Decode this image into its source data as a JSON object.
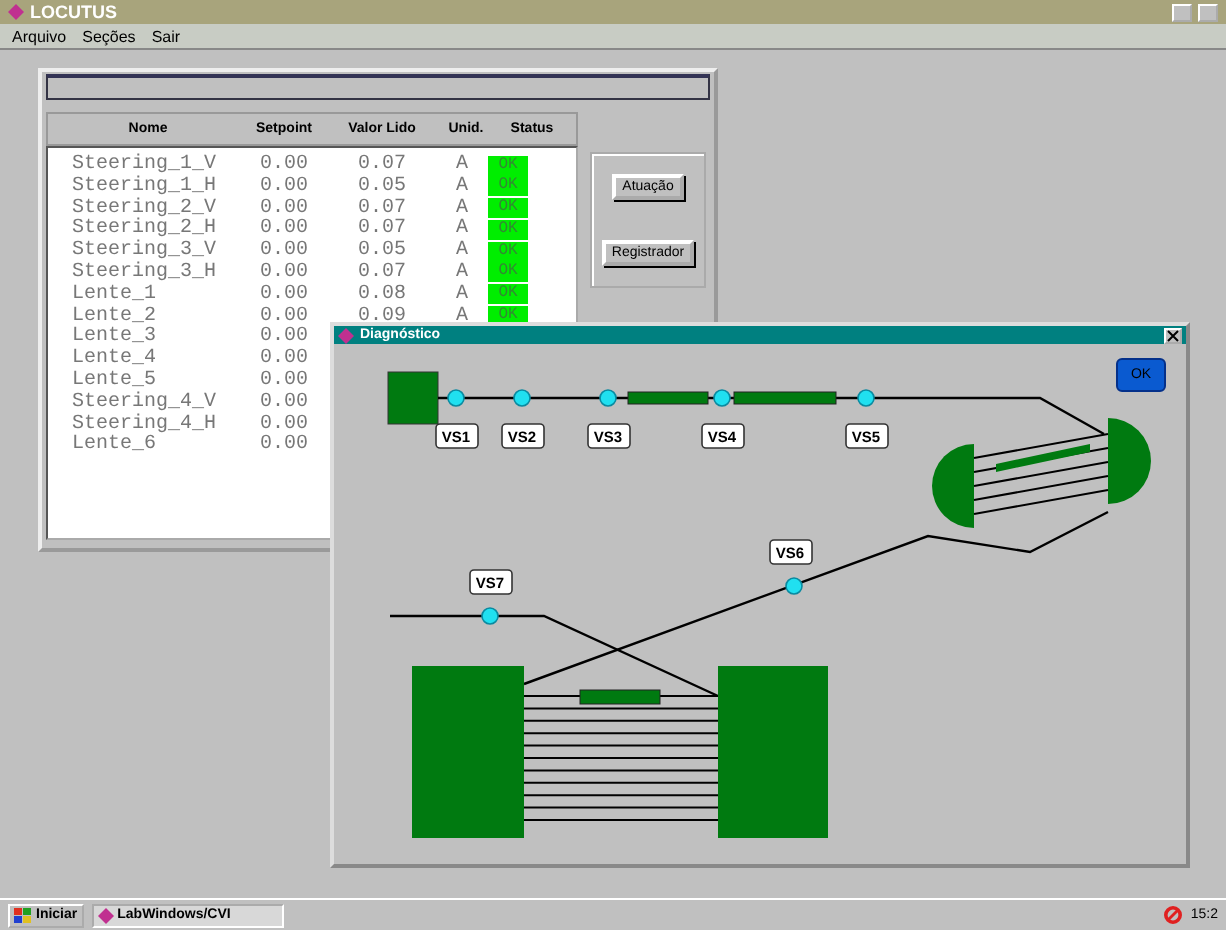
{
  "app": {
    "title": "LOCUTUS"
  },
  "menu": [
    "Arquivo",
    "Seções",
    "Sair"
  ],
  "table": {
    "columns": [
      "Nome",
      "Setpoint",
      "Valor Lido",
      "Unid.",
      "Status"
    ],
    "rows": [
      {
        "name": "Steering_1_V",
        "setpoint": "0.00",
        "value": "0.07",
        "unit": "A",
        "status": "OK"
      },
      {
        "name": "Steering_1_H",
        "setpoint": "0.00",
        "value": "0.05",
        "unit": "A",
        "status": "OK"
      },
      {
        "name": "Steering_2_V",
        "setpoint": "0.00",
        "value": "0.07",
        "unit": "A",
        "status": "OK"
      },
      {
        "name": "Steering_2_H",
        "setpoint": "0.00",
        "value": "0.07",
        "unit": "A",
        "status": "OK"
      },
      {
        "name": "Steering_3_V",
        "setpoint": "0.00",
        "value": "0.05",
        "unit": "A",
        "status": "OK"
      },
      {
        "name": "Steering_3_H",
        "setpoint": "0.00",
        "value": "0.07",
        "unit": "A",
        "status": "OK"
      },
      {
        "name": "Lente_1",
        "setpoint": "0.00",
        "value": "0.08",
        "unit": "A",
        "status": "OK"
      },
      {
        "name": "Lente_2",
        "setpoint": "0.00",
        "value": "0.09",
        "unit": "A",
        "status": "OK"
      },
      {
        "name": "Lente_3",
        "setpoint": "0.00"
      },
      {
        "name": "Lente_4",
        "setpoint": "0.00"
      },
      {
        "name": "Lente_5",
        "setpoint": "0.00"
      },
      {
        "name": "Steering_4_V",
        "setpoint": "0.00"
      },
      {
        "name": "Steering_4_H",
        "setpoint": "0.00"
      },
      {
        "name": "Lente_6",
        "setpoint": "0.00"
      }
    ]
  },
  "buttons": [
    "Atuação",
    "Registrador"
  ],
  "diagnostics": {
    "title": "Diagnóstico",
    "ok_button": "OK",
    "valves": [
      {
        "label": "VS1"
      },
      {
        "label": "VS2"
      },
      {
        "label": "VS3"
      },
      {
        "label": "VS4"
      },
      {
        "label": "VS5"
      },
      {
        "label": "VS6"
      },
      {
        "label": "VS7"
      }
    ]
  },
  "taskbar": {
    "start": "Iniciar",
    "tasks": [
      "LabWindows/CVI"
    ],
    "clock": "15:2"
  }
}
